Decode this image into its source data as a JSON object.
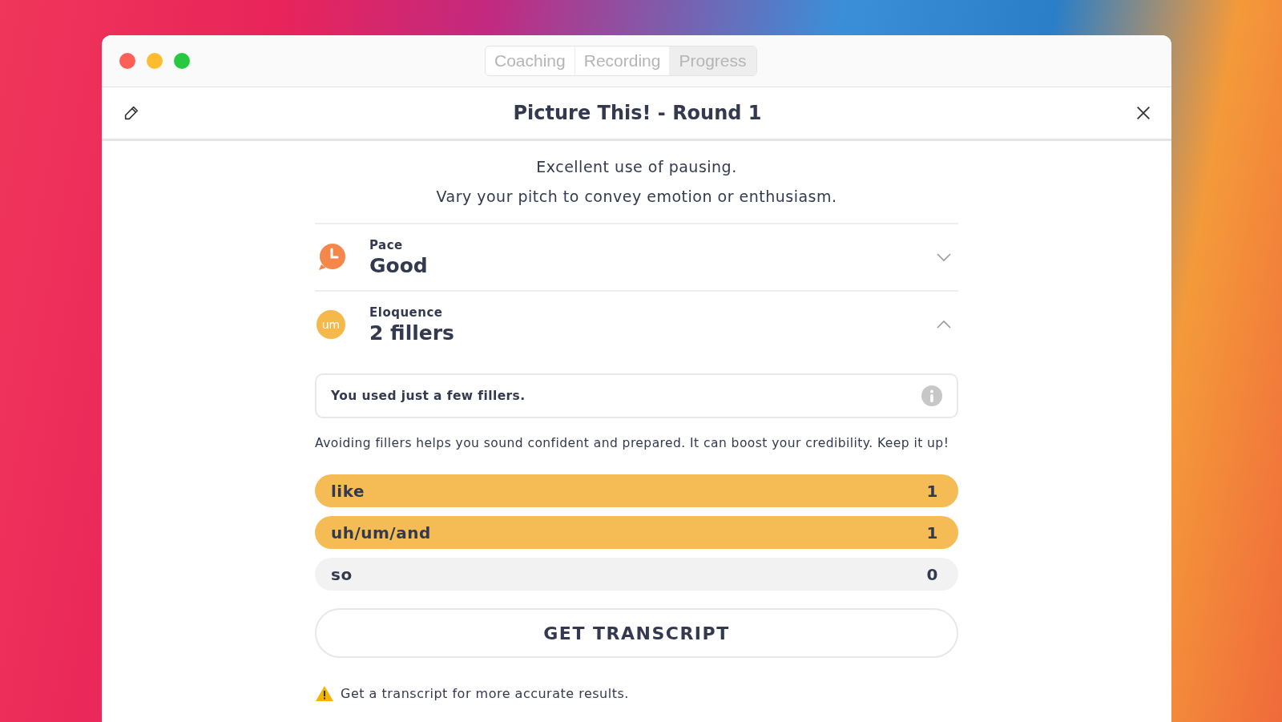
{
  "window": {
    "tabs": [
      {
        "label": "Coaching",
        "selected": false
      },
      {
        "label": "Recording",
        "selected": false
      },
      {
        "label": "Progress",
        "selected": true
      }
    ]
  },
  "header": {
    "title": "Picture This! - Round 1"
  },
  "messages": [
    "Excellent use of pausing.",
    "Vary your pitch to convey emotion or enthusiasm."
  ],
  "metrics": [
    {
      "kind": "pace",
      "label": "Pace",
      "value": "Good",
      "expanded": false
    },
    {
      "kind": "eloquence",
      "label": "Eloquence",
      "value": "2 fillers",
      "badge": "um",
      "expanded": true
    }
  ],
  "summary": {
    "text": "You used just a few fillers."
  },
  "advice": "Avoiding fillers helps you sound confident and prepared. It can boost your credibility. Keep it up!",
  "fillers": [
    {
      "word": "like",
      "count": "1",
      "highlighted": true
    },
    {
      "word": "uh/um/and",
      "count": "1",
      "highlighted": true
    },
    {
      "word": "so",
      "count": "0",
      "highlighted": false
    }
  ],
  "transcript_button": "GET TRANSCRIPT",
  "warning": "Get a transcript for more accurate results."
}
